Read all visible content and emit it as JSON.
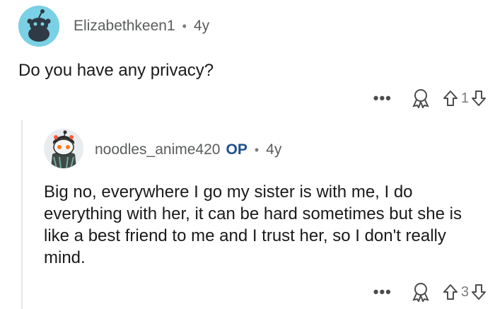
{
  "comments": [
    {
      "username": "Elizabethkeen1",
      "separator": "•",
      "age": "4y",
      "op_badge": "",
      "text": "Do you have any privacy?",
      "vote_count": "1",
      "more_label": "•••"
    },
    {
      "username": "noodles_anime420",
      "separator": "•",
      "age": "4y",
      "op_badge": "OP",
      "text": "Big no, everywhere I go my sister is with me, I do everything with her, it can be hard sometimes but she is like a best friend to me and I trust her, so I don't really mind.",
      "vote_count": "3",
      "more_label": "•••"
    }
  ],
  "colors": {
    "avatar1_bg": "#7ad0e4",
    "op_badge": "#1e4f8c",
    "meta_text": "#5a5c5e",
    "icon_stroke": "#4a4c4e"
  },
  "icons": {
    "avatar": "snoo-avatar-icon",
    "more": "more-options-icon",
    "award": "award-icon",
    "upvote": "upvote-arrow-icon",
    "downvote": "downvote-arrow-icon"
  }
}
